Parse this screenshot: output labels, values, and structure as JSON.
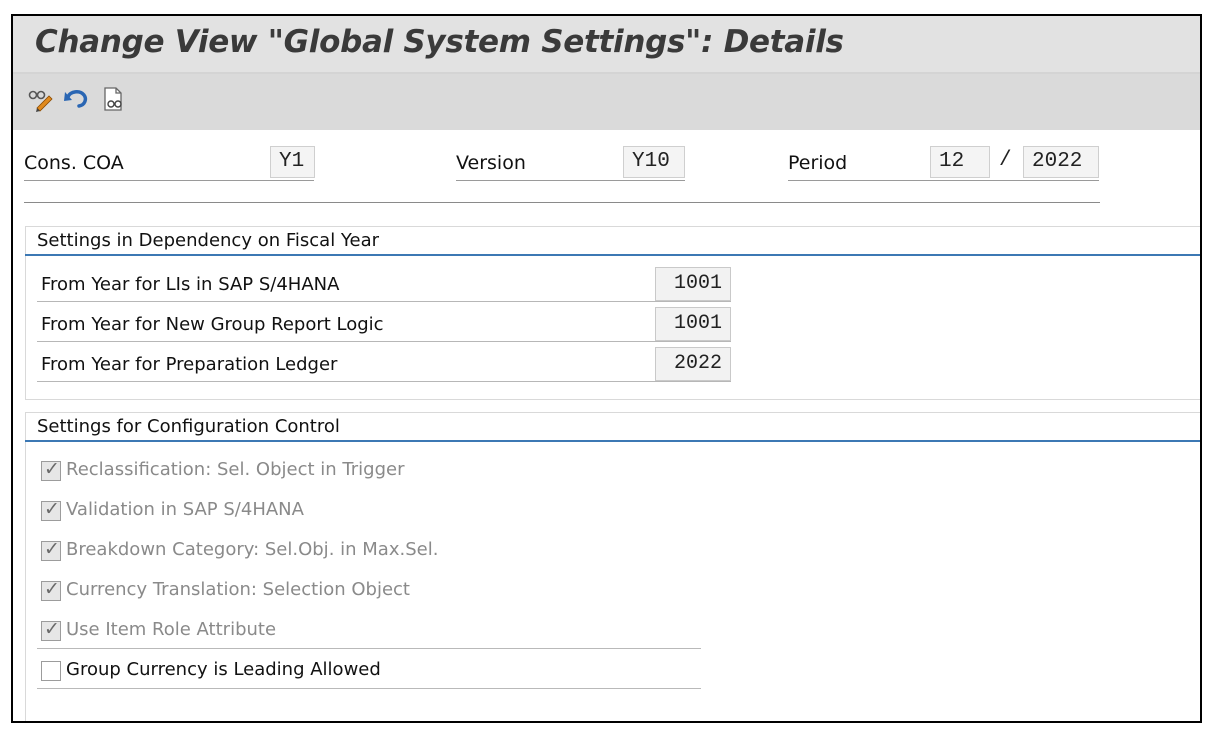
{
  "window": {
    "title": "Change View \"Global System Settings\": Details"
  },
  "toolbar": {
    "icons": [
      "display-change-icon",
      "undo-icon",
      "where-used-icon"
    ]
  },
  "header": {
    "cons_coa_label": "Cons. COA",
    "cons_coa_value": "Y1",
    "version_label": "Version",
    "version_value": "Y10",
    "period_label": "Period",
    "period_value": "12",
    "period_separator": "/",
    "year_value": "2022"
  },
  "fiscal_year_group": {
    "title": "Settings in Dependency on Fiscal Year",
    "rows": [
      {
        "label": "From Year for LIs in SAP S/4HANA",
        "value": "1001"
      },
      {
        "label": "From Year for New Group Report Logic",
        "value": "1001"
      },
      {
        "label": "From Year for Preparation Ledger",
        "value": "2022"
      }
    ]
  },
  "config_group": {
    "title": "Settings for Configuration Control",
    "checkboxes": [
      {
        "label": "Reclassification: Sel. Object in Trigger",
        "checked": true,
        "enabled": false
      },
      {
        "label": "Validation in SAP S/4HANA",
        "checked": true,
        "enabled": false
      },
      {
        "label": "Breakdown Category: Sel.Obj. in Max.Sel.",
        "checked": true,
        "enabled": false
      },
      {
        "label": "Currency Translation: Selection Object",
        "checked": true,
        "enabled": false
      },
      {
        "label": "Use Item Role Attribute",
        "checked": true,
        "enabled": false
      },
      {
        "label": "Group Currency is Leading Allowed",
        "checked": false,
        "enabled": true
      }
    ]
  },
  "colors": {
    "group_rule": "#3c78b4",
    "titlebar_bg": "#e2e2e2",
    "toolbar_bg": "#dadada"
  }
}
